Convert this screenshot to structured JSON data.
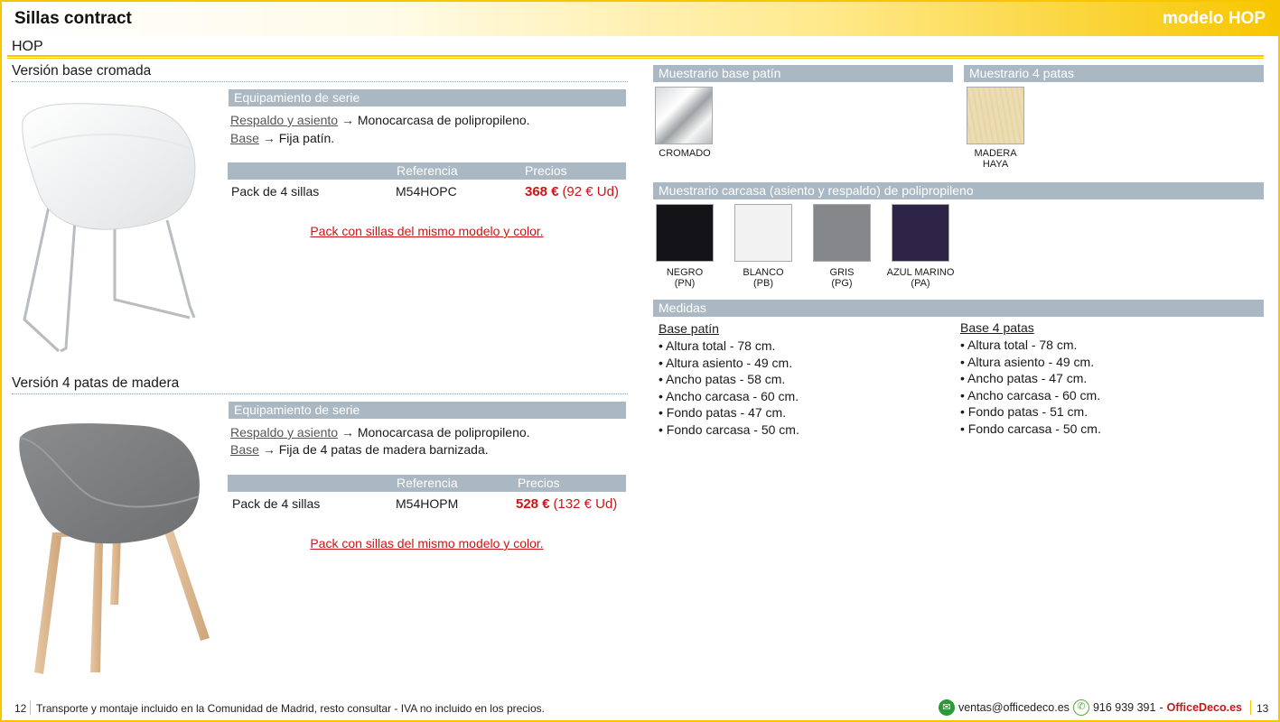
{
  "header": {
    "title": "Sillas contract",
    "model": "modelo HOP"
  },
  "subtitle": "HOP",
  "versions": [
    {
      "title": "Versión base cromada",
      "equip_title": "Equipamiento de serie",
      "lines": [
        {
          "label": "Respaldo y asiento",
          "text": "Monocarcasa de polipropileno."
        },
        {
          "label": "Base",
          "text": "Fija patín."
        }
      ],
      "col_ref": "Referencia",
      "col_price": "Precios",
      "row_name": "Pack de 4 sillas",
      "ref": "M54HOPC",
      "price": "368 €",
      "unit_price": "(92 € Ud)",
      "note": "Pack con sillas del mismo modelo y color."
    },
    {
      "title": "Versión 4 patas de madera",
      "equip_title": "Equipamiento de serie",
      "lines": [
        {
          "label": "Respaldo y asiento",
          "text": "Monocarcasa de polipropileno."
        },
        {
          "label": "Base",
          "text": "Fija de 4 patas de madera barnizada."
        }
      ],
      "col_ref": "Referencia",
      "col_price": "Precios",
      "row_name": "Pack de 4 sillas",
      "ref": "M54HOPM",
      "price": "528 €",
      "unit_price": "(132 € Ud)",
      "note": "Pack con sillas del mismo modelo y color."
    }
  ],
  "arrow": "→",
  "muestrario_patin": {
    "title": "Muestrario base patín",
    "swatches": [
      {
        "label": "CROMADO"
      }
    ]
  },
  "muestrario_4patas": {
    "title": "Muestrario 4 patas",
    "swatches": [
      {
        "label1": "MADERA",
        "label2": "HAYA",
        "color": "#ecdcb2"
      }
    ]
  },
  "muestrario_carcasa": {
    "title": "Muestrario carcasa (asiento y respaldo) de polipropileno",
    "swatches": [
      {
        "name": "NEGRO",
        "code": "(PN)",
        "color": "#141418"
      },
      {
        "name": "BLANCO",
        "code": "(PB)",
        "color": "#f2f2f2"
      },
      {
        "name": "GRIS",
        "code": "(PG)",
        "color": "#85878a"
      },
      {
        "name": "AZUL MARINO",
        "code": "(PA)",
        "color": "#2c2346"
      }
    ]
  },
  "medidas": {
    "title": "Medidas",
    "base_patin": {
      "heading": "Base patín",
      "items": [
        "Altura total - 78 cm.",
        "Altura asiento - 49 cm.",
        "Ancho patas - 58 cm.",
        "Ancho carcasa - 60 cm.",
        "Fondo patas - 47 cm.",
        "Fondo carcasa - 50 cm."
      ]
    },
    "base_4patas": {
      "heading": "Base 4 patas",
      "items": [
        "Altura total - 78 cm.",
        "Altura asiento - 49 cm.",
        "Ancho patas - 47 cm.",
        "Ancho carcasa - 60 cm.",
        "Fondo patas - 51 cm.",
        "Fondo carcasa - 50 cm."
      ]
    }
  },
  "footer": {
    "page_left": "12",
    "text": "Transporte y montaje incluido en la Comunidad de Madrid, resto consultar - IVA no incluido en los precios.",
    "email": "ventas@officedeco.es",
    "phone": "916 939 391",
    "dash": "-",
    "brand": "OfficeDeco.es",
    "page_right": "13"
  },
  "colors": {
    "accent": "#f7c600",
    "header_gray": "#a9b8c3",
    "price_red": "#cc1616"
  }
}
